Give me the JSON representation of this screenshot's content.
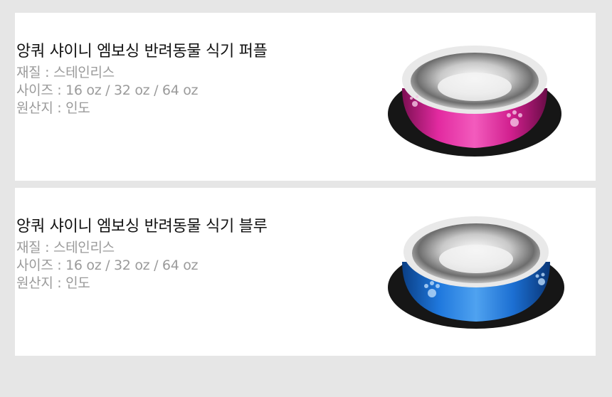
{
  "products": [
    {
      "title": "앙쿼 샤이니 엠보싱 반려동물 식기 퍼플",
      "material": "재질 : 스테인리스",
      "size": "사이즈 : 16 oz / 32 oz / 64 oz",
      "origin": "원산지 : 인도",
      "bowl_color": "#d21f8c"
    },
    {
      "title": "앙쿼 샤이니 엠보싱 반려동물 식기 블루",
      "material": "재질 : 스테인리스",
      "size": "사이즈 : 16 oz / 32 oz / 64 oz",
      "origin": "원산지 : 인도",
      "bowl_color": "#1f6fd6"
    }
  ]
}
